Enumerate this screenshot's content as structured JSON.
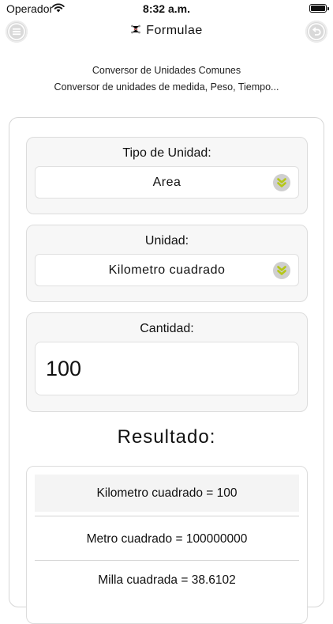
{
  "status_bar": {
    "carrier": "Operador",
    "time": "8:32 a.m."
  },
  "nav": {
    "title": "Formulae",
    "menu_icon": "hamburger-menu-icon",
    "back_icon": "undo-back-icon",
    "app_icon": "molecule-icon"
  },
  "header": {
    "subtitle_1": "Conversor de Unidades Comunes",
    "subtitle_2": "Conversor de unidades de medida, Peso, Tiempo..."
  },
  "form": {
    "unit_type": {
      "label": "Tipo de Unidad:",
      "value": "Area"
    },
    "unit": {
      "label": "Unidad:",
      "value": "Kilometro cuadrado"
    },
    "quantity": {
      "label": "Cantidad:",
      "value": "100"
    }
  },
  "results": {
    "title": "Resultado:",
    "items": [
      "Kilometro cuadrado = 100",
      "Metro cuadrado = 100000000",
      "Milla cuadrada = 38.6102"
    ]
  },
  "colors": {
    "chevron_accent": "#b5c718",
    "button_gray": "#d9d9d9",
    "panel_bg": "#f7f7f7"
  }
}
